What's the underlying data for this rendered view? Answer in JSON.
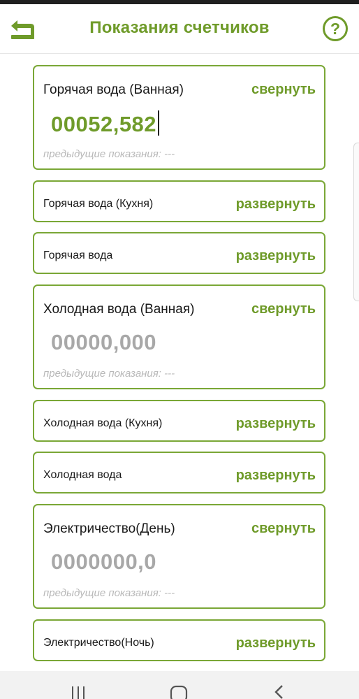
{
  "header": {
    "title": "Показания счетчиков",
    "back_icon": "back-arrow-icon",
    "help_icon": "help-icon",
    "accent_color": "#6f9b2a"
  },
  "cards": [
    {
      "label": "Горячая вода (Ванная)",
      "toggle": "свернуть",
      "value": "00052,582",
      "prev": "предыдущие показания: ---"
    },
    {
      "label": "Горячая вода (Кухня)",
      "toggle": "развернуть"
    },
    {
      "label": "Горячая вода",
      "toggle": "развернуть"
    },
    {
      "label": "Холодная вода (Ванная)",
      "toggle": "свернуть",
      "placeholder": "00000,000",
      "prev": "предыдущие показания: ---"
    },
    {
      "label": "Холодная вода (Кухня)",
      "toggle": "развернуть"
    },
    {
      "label": "Холодная вода",
      "toggle": "развернуть"
    },
    {
      "label": "Электричество(День)",
      "toggle": "свернуть",
      "placeholder": "0000000,0",
      "prev": "предыдущие показания: ---"
    },
    {
      "label": "Электричество(Ночь)",
      "toggle": "развернуть"
    }
  ],
  "navbar": {
    "recent_icon": "recent-apps-icon",
    "home_icon": "home-icon",
    "back_icon": "back-chevron-icon"
  }
}
